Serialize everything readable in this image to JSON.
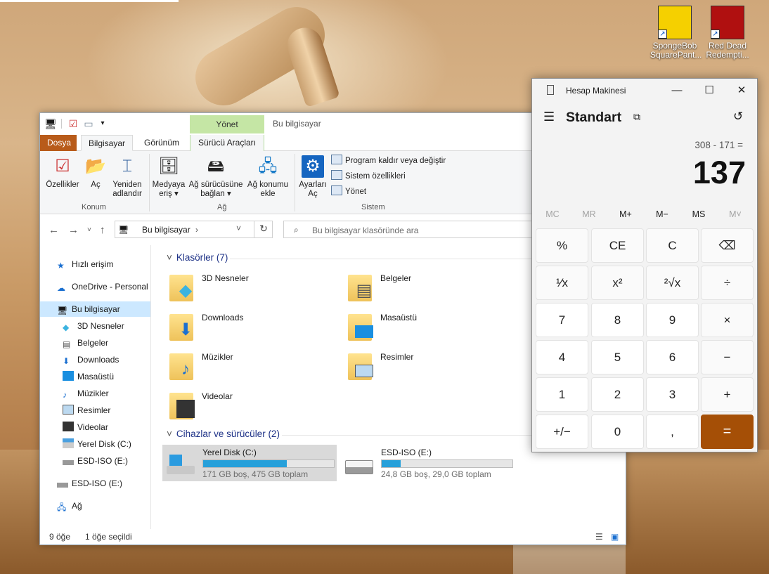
{
  "desktop": {
    "icons": [
      {
        "label": "SpongeBob SquarePant...",
        "color": "#f5d000"
      },
      {
        "label": "Red Dead Redempti...",
        "color": "#b01010"
      }
    ]
  },
  "explorer": {
    "title": "Bu bilgisayar",
    "context_tab_header": "Yönet",
    "tabs": [
      {
        "label": "Dosya"
      },
      {
        "label": "Bilgisayar"
      },
      {
        "label": "Görünüm"
      },
      {
        "label": "Sürücü Araçları"
      }
    ],
    "ribbon": {
      "konum": {
        "label": "Konum",
        "buttons": [
          {
            "label": "Özellikler"
          },
          {
            "label": "Aç"
          },
          {
            "label": "Yeniden adlandır"
          }
        ]
      },
      "ag": {
        "label": "Ağ",
        "buttons": [
          {
            "label": "Medyaya eriş"
          },
          {
            "label": "Ağ sürücüsüne bağlan"
          },
          {
            "label": "Ağ konumu ekle"
          }
        ]
      },
      "sistem": {
        "label": "Sistem",
        "big_button": "Ayarları Aç",
        "items": [
          {
            "label": "Program kaldır veya değiştir"
          },
          {
            "label": "Sistem özellikleri"
          },
          {
            "label": "Yönet"
          }
        ]
      }
    },
    "address": {
      "path": "Bu bilgisayar",
      "search_placeholder": "Bu bilgisayar klasöründe ara"
    },
    "nav": {
      "quick_access": "Hızlı erişim",
      "onedrive": "OneDrive - Personal",
      "this_pc": "Bu bilgisayar",
      "children": [
        {
          "label": "3D Nesneler"
        },
        {
          "label": "Belgeler"
        },
        {
          "label": "Downloads"
        },
        {
          "label": "Masaüstü"
        },
        {
          "label": "Müzikler"
        },
        {
          "label": "Resimler"
        },
        {
          "label": "Videolar"
        },
        {
          "label": "Yerel Disk (C:)"
        },
        {
          "label": "ESD-ISO (E:)"
        }
      ],
      "esd": "ESD-ISO (E:)",
      "network": "Ağ"
    },
    "sections": {
      "folders_title": "Klasörler (7)",
      "devices_title": "Cihazlar ve sürücüler (2)"
    },
    "folders": [
      {
        "label": "3D Nesneler"
      },
      {
        "label": "Belgeler"
      },
      {
        "label": "Downloads"
      },
      {
        "label": "Masaüstü"
      },
      {
        "label": "Müzikler"
      },
      {
        "label": "Resimler"
      },
      {
        "label": "Videolar"
      }
    ],
    "drives": [
      {
        "label": "Yerel Disk (C:)",
        "size_text": "171 GB boş, 475 GB toplam",
        "used_fraction": 0.64,
        "selected": true
      },
      {
        "label": "ESD-ISO (E:)",
        "size_text": "24,8 GB boş, 29,0 GB toplam",
        "used_fraction": 0.145,
        "selected": false
      }
    ],
    "status": {
      "items": "9 öğe",
      "selected": "1 öğe seçildi"
    }
  },
  "calculator": {
    "title": "Hesap Makinesi",
    "mode": "Standart",
    "expression": "308 - 171 =",
    "result": "137",
    "memory": [
      {
        "label": "MC",
        "enabled": false
      },
      {
        "label": "MR",
        "enabled": false
      },
      {
        "label": "M+",
        "enabled": true
      },
      {
        "label": "M−",
        "enabled": true
      },
      {
        "label": "MS",
        "enabled": true
      },
      {
        "label": "M˅",
        "enabled": false
      }
    ],
    "keys": [
      [
        "%",
        "CE",
        "C",
        "⌫"
      ],
      [
        "¹⁄x",
        "x²",
        "²√x",
        "÷"
      ],
      [
        "7",
        "8",
        "9",
        "×"
      ],
      [
        "4",
        "5",
        "6",
        "−"
      ],
      [
        "1",
        "2",
        "3",
        "+"
      ],
      [
        "+/−",
        "0",
        ",",
        "="
      ]
    ],
    "accent": "#a54f06"
  }
}
